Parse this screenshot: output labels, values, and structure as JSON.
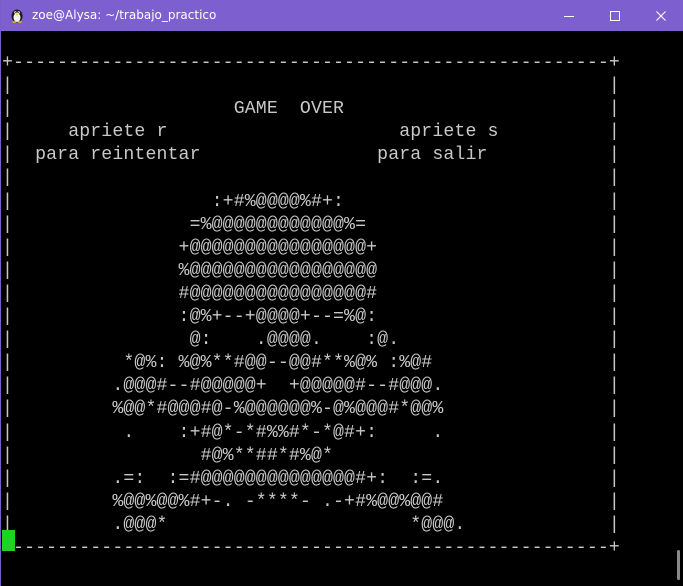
{
  "window": {
    "title": "zoe@Alysa: ~/trabajo_practico",
    "app_icon": "terminal-penguin-icon",
    "controls": {
      "minimize_icon": "minimize-icon",
      "maximize_icon": "maximize-icon",
      "close_icon": "close-icon"
    },
    "accent_color": "#7d5fcf"
  },
  "terminal": {
    "lines": [
      "+------------------------------------------------------+",
      "|                                                      |",
      "|                    GAME  OVER                        |",
      "|     apriete r                     apriete s          |",
      "|  para reintentar                para salir           |",
      "|                                                      |",
      "|                  :+#%@@@@%#+:                        |",
      "|                =%@@@@@@@@@@@@%=                      |",
      "|               +@@@@@@@@@@@@@@@@+                     |",
      "|               %@@@@@@@@@@@@@@@@@                     |",
      "|               #@@@@@@@@@@@@@@@@#                     |",
      "|               :@%+--+@@@@+--=%@:                     |",
      "|                @:    .@@@@.    :@.                   |",
      "|          *@%: %@%**#@@--@@#**%@% :%@#                |",
      "|         .@@@#--#@@@@@+  +@@@@@#--#@@@.               |",
      "|         %@@*#@@@#@-%@@@@@@%-@%@@@#*@@%               |",
      "|          .    :+#@*-*#%%#*-*@#+:     .               |",
      "|                 #@%**##*#%@*                         |",
      "|         .=:  :=#@@@@@@@@@@@@@@#+:  :=.               |",
      "|         %@@%@@%#+-. -****- .-+#%@@%@@#               |",
      "|         .@@@*                      *@@@.             |",
      "+------------------------------------------------------+"
    ],
    "cursor_color": "#1ed51e",
    "text_color": "#c8c8c8"
  }
}
